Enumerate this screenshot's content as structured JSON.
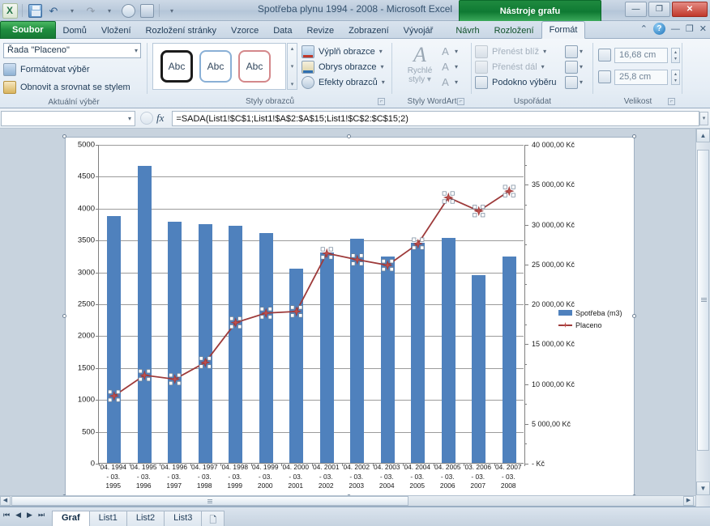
{
  "window": {
    "title": "Spotřeba plynu 1994 - 2008  -  Microsoft Excel",
    "context_banner": "Nástroje grafu",
    "minimize": "—",
    "restore": "❐",
    "close": "✕"
  },
  "quick_access": {
    "app_icon": "excel-logo-icon",
    "save": "save-icon",
    "undo": "undo-icon",
    "undo_dd": "▾",
    "redo": "redo-icon",
    "redo_dd": "▾",
    "print_preview": "print-preview-icon",
    "quick_print": "quick-print-icon",
    "customize": "▾"
  },
  "tabs": {
    "file": "Soubor",
    "items": [
      "Domů",
      "Vložení",
      "Rozložení stránky",
      "Vzorce",
      "Data",
      "Revize",
      "Zobrazení",
      "Vývojář"
    ],
    "context_items": [
      "Návrh",
      "Rozložení",
      "Formát"
    ],
    "active": "Formát",
    "minimize_ribbon": "⌃",
    "help": "?",
    "win_min": "—",
    "win_restore": "❐",
    "win_close": "✕"
  },
  "ribbon": {
    "current_selection": {
      "label": "Aktuální výběr",
      "series_box": "Řada \"Placeno\"",
      "series_box_caret": "▾",
      "format_selection": "Formátovat výběr",
      "reset_to_match_style": "Obnovit a srovnat se stylem"
    },
    "shape_styles": {
      "label": "Styly obrazců",
      "gallery": [
        "Abc",
        "Abc",
        "Abc"
      ],
      "scroll_up": "▴",
      "scroll_down": "▾",
      "scroll_more": "▾",
      "shape_fill": "Výplň obrazce",
      "shape_outline": "Obrys obrazce",
      "shape_effects": "Efekty obrazců",
      "dropdown_caret": "▾",
      "dialog_launcher": "⌐"
    },
    "wordart_styles": {
      "label": "Styly WordArt",
      "quick_styles_line1": "Rychlé",
      "quick_styles_line2": "styly",
      "quick_styles_caret": "▾",
      "text_fill": "A",
      "text_outline": "A",
      "text_effects": "A",
      "caret": "▾",
      "dialog_launcher": "⌐"
    },
    "arrange": {
      "label": "Uspořádat",
      "bring_forward": "Přenést blíž",
      "send_backward": "Přenést dál",
      "selection_pane": "Podokno výběru",
      "align": "align-icon",
      "group": "group-icon",
      "rotate": "rotate-icon",
      "caret": "▾"
    },
    "size": {
      "label": "Velikost",
      "height_value": "16,68 cm",
      "width_value": "25,8 cm",
      "height_icon": "shape-height-icon",
      "width_icon": "shape-width-icon",
      "spin_up": "▴",
      "spin_down": "▾",
      "dialog_launcher": "⌐"
    }
  },
  "formula_bar": {
    "name_box_value": "",
    "name_box_caret": "▾",
    "cancel": "✕",
    "enter": "✓",
    "insert_function": "fx",
    "formula": "=SADA(List1!$C$1;List1!$A$2:$A$15;List1!$C$2:$C$15;2)",
    "expand": "▾"
  },
  "sheet_tabs": {
    "first": "⏮",
    "prev": "◀",
    "next": "▶",
    "last": "⏭",
    "items": [
      "Graf",
      "List1",
      "List2",
      "List3"
    ],
    "active": "Graf",
    "new_sheet_icon": "new-sheet-icon"
  },
  "scrollbars": {
    "up": "▲",
    "down": "▼",
    "left": "◀",
    "right": "▶"
  },
  "colors": {
    "series_bar": "#4f81bd",
    "series_line": "#9e3b3b",
    "marker": "#c0504d",
    "accent_green": "#1e8c3e",
    "gridline": "#9b9b9b",
    "axis": "#808080"
  },
  "chart_data": {
    "type": "bar",
    "title": "",
    "xlabel": "",
    "ylabel": "",
    "grid": true,
    "legend_position": "right",
    "categories": [
      "04. 1994 - 03. 1995",
      "04. 1995 - 03. 1996",
      "04. 1996 - 03. 1997",
      "04. 1997 - 03. 1998",
      "04. 1998 - 03. 1999",
      "04. 1999 - 03. 2000",
      "04. 2000 - 03. 2001",
      "04. 2001 - 03. 2002",
      "04. 2002 - 03. 2003",
      "04. 2003 - 03. 2004",
      "04. 2004 - 03. 2005",
      "04. 2005 - 03. 2006",
      "03. 2006 - 03. 2007",
      "04. 2007 - 03. 2008"
    ],
    "category_lines": [
      [
        "04. 1994",
        "- 03.",
        "1995"
      ],
      [
        "04. 1995",
        "- 03.",
        "1996"
      ],
      [
        "04. 1996",
        "- 03.",
        "1997"
      ],
      [
        "04. 1997",
        "- 03.",
        "1998"
      ],
      [
        "04. 1998",
        "- 03.",
        "1999"
      ],
      [
        "04. 1999",
        "- 03.",
        "2000"
      ],
      [
        "04. 2000",
        "- 03.",
        "2001"
      ],
      [
        "04. 2001",
        "- 03.",
        "2002"
      ],
      [
        "04. 2002",
        "- 03.",
        "2003"
      ],
      [
        "04. 2003",
        "- 03.",
        "2004"
      ],
      [
        "04. 2004",
        "- 03.",
        "2005"
      ],
      [
        "04. 2005",
        "- 03.",
        "2006"
      ],
      [
        "03. 2006",
        "- 03.",
        "2007"
      ],
      [
        "04. 2007",
        "- 03.",
        "2008"
      ]
    ],
    "series": [
      {
        "name": "Spotřeba (m3)",
        "type": "bar",
        "axis": "left",
        "color": "#4f81bd",
        "values": [
          3870,
          4660,
          3780,
          3740,
          3720,
          3600,
          3050,
          3300,
          3520,
          3230,
          3450,
          3530,
          2940,
          3230
        ]
      },
      {
        "name": "Placeno",
        "type": "line",
        "axis": "right",
        "color": "#9e3b3b",
        "marker_color": "#c0504d",
        "values": [
          8500,
          11100,
          10600,
          12700,
          17700,
          18900,
          19100,
          26400,
          25600,
          24900,
          27600,
          33400,
          31700,
          34200
        ]
      }
    ],
    "y_axis_left": {
      "min": 0,
      "max": 5000,
      "step": 500,
      "ticks": [
        "0",
        "500",
        "1000",
        "1500",
        "2000",
        "2500",
        "3000",
        "3500",
        "4000",
        "4500",
        "5000"
      ]
    },
    "y_axis_right": {
      "min": 0,
      "max": 40000,
      "step": 5000,
      "ticks": [
        "-   Kč",
        "5 000,00 Kč",
        "10 000,00 Kč",
        "15 000,00 Kč",
        "20 000,00 Kč",
        "25 000,00 Kč",
        "30 000,00 Kč",
        "35 000,00 Kč",
        "40 000,00 Kč"
      ]
    },
    "legend": [
      "Spotřeba (m3)",
      "Placeno"
    ]
  }
}
